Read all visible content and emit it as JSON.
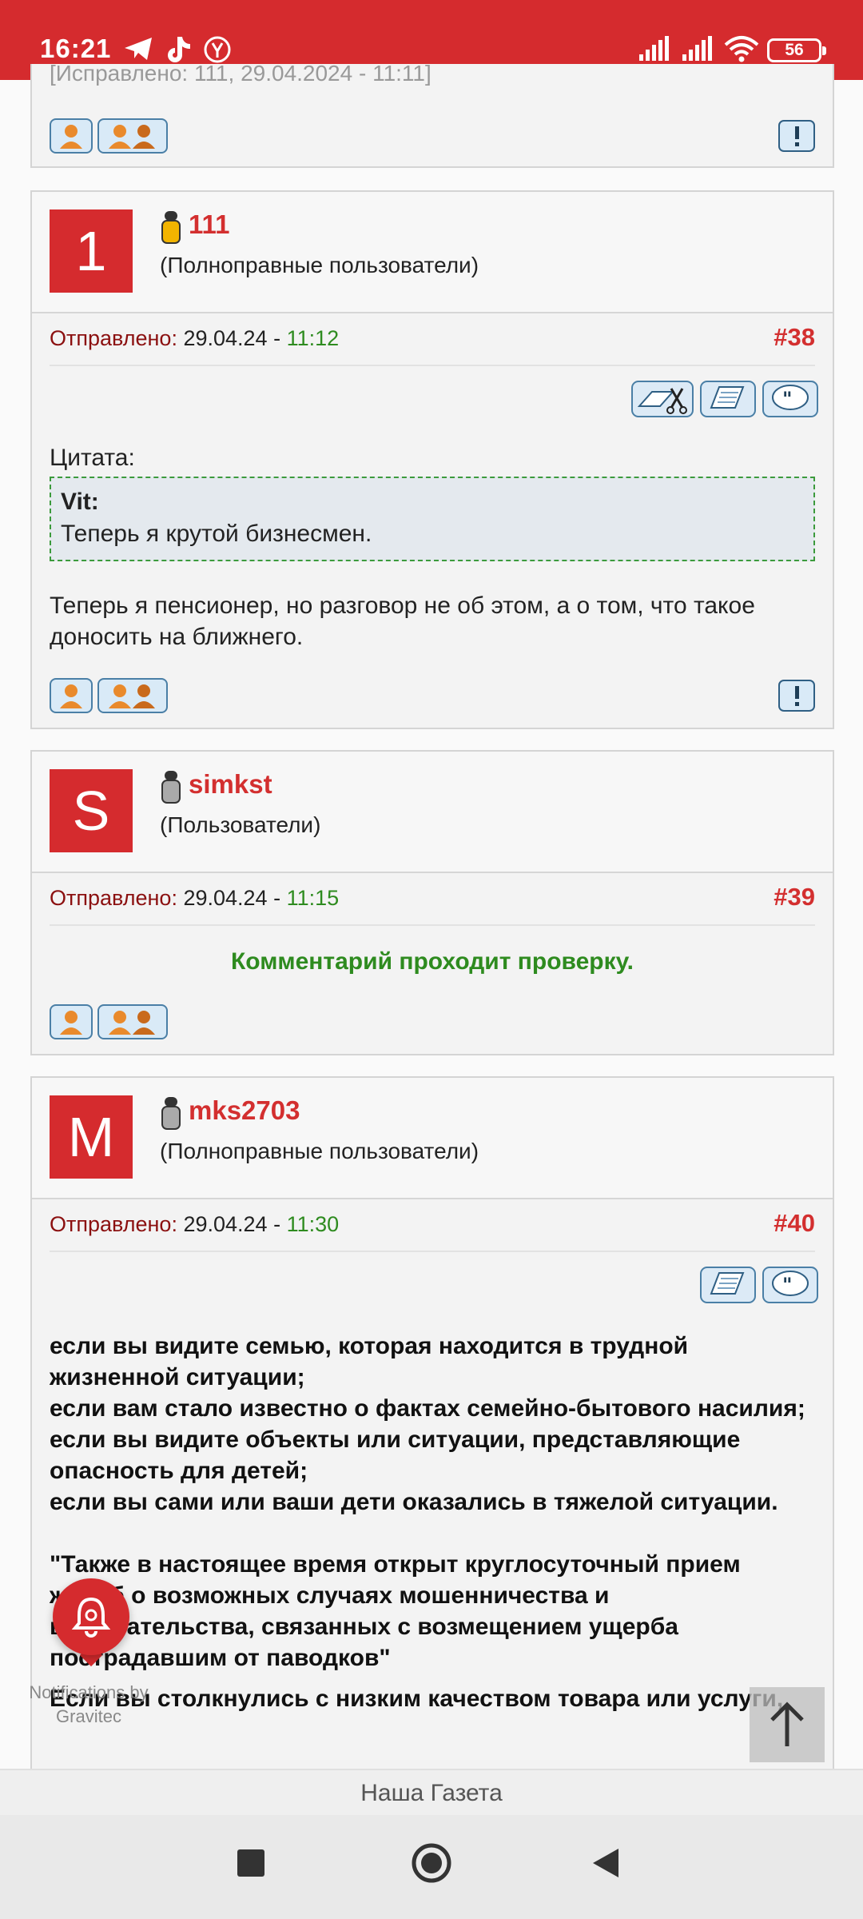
{
  "status_bar": {
    "time": "16:21",
    "battery": "56",
    "color": "#d52b2e"
  },
  "top_partial": {
    "edited_text": "[Исправлено: 111, 29.04.2024 - 11:11]"
  },
  "posts": [
    {
      "avatar_letter": "1",
      "username": "111",
      "group": "(Полноправные пользователи)",
      "sent_label": "Отправлено:",
      "date": "29.04.24 -",
      "time": "11:12",
      "number": "#38",
      "quote_label": "Цитата:",
      "quote_author": "Vit:",
      "quote_text": "Теперь я крутой бизнесмен.",
      "text": "Теперь я пенсионер, но разговор не об этом, а о том, что такое доносить на ближнего."
    },
    {
      "avatar_letter": "S",
      "username": "simkst",
      "group": "(Пользователи)",
      "sent_label": "Отправлено:",
      "date": "29.04.24 -",
      "time": "11:15",
      "number": "#39",
      "moderation": "Комментарий проходит проверку."
    },
    {
      "avatar_letter": "M",
      "username": "mks2703",
      "group": "(Полноправные пользователи)",
      "sent_label": "Отправлено:",
      "date": "29.04.24 -",
      "time": "11:30",
      "number": "#40",
      "lines": [
        "если вы видите семью, которая находится в трудной жизненной ситуации;",
        "если вам стало известно о фактах семейно-бытового насилия;",
        "если вы видите объекты или ситуации, представляющие опасность для детей;",
        "если вы сами или ваши дети оказались в тяжелой ситуации."
      ],
      "quote_text": "\"Также в настоящее время открыт круглосуточный прием жалоб о возможных случаях мошенничества и вымогательства, связанных с возмещением ущерба пострадавшим от паводков\"",
      "tail_text": "Если вы столкнулись с низким качеством товара или услуги,"
    }
  ],
  "notification": {
    "label_line1": "Notifications by",
    "label_line2": "Gravitec"
  },
  "bottom": {
    "site_name": "Наша Газета"
  },
  "icons": [
    "telegram-icon",
    "tiktok-icon",
    "yandex-icon",
    "signal-icon",
    "wifi-icon",
    "battery-icon",
    "user-icon",
    "users-icon",
    "report-icon",
    "edit-icon",
    "reply-icon",
    "quote-icon",
    "bell-icon",
    "arrow-up-icon"
  ]
}
